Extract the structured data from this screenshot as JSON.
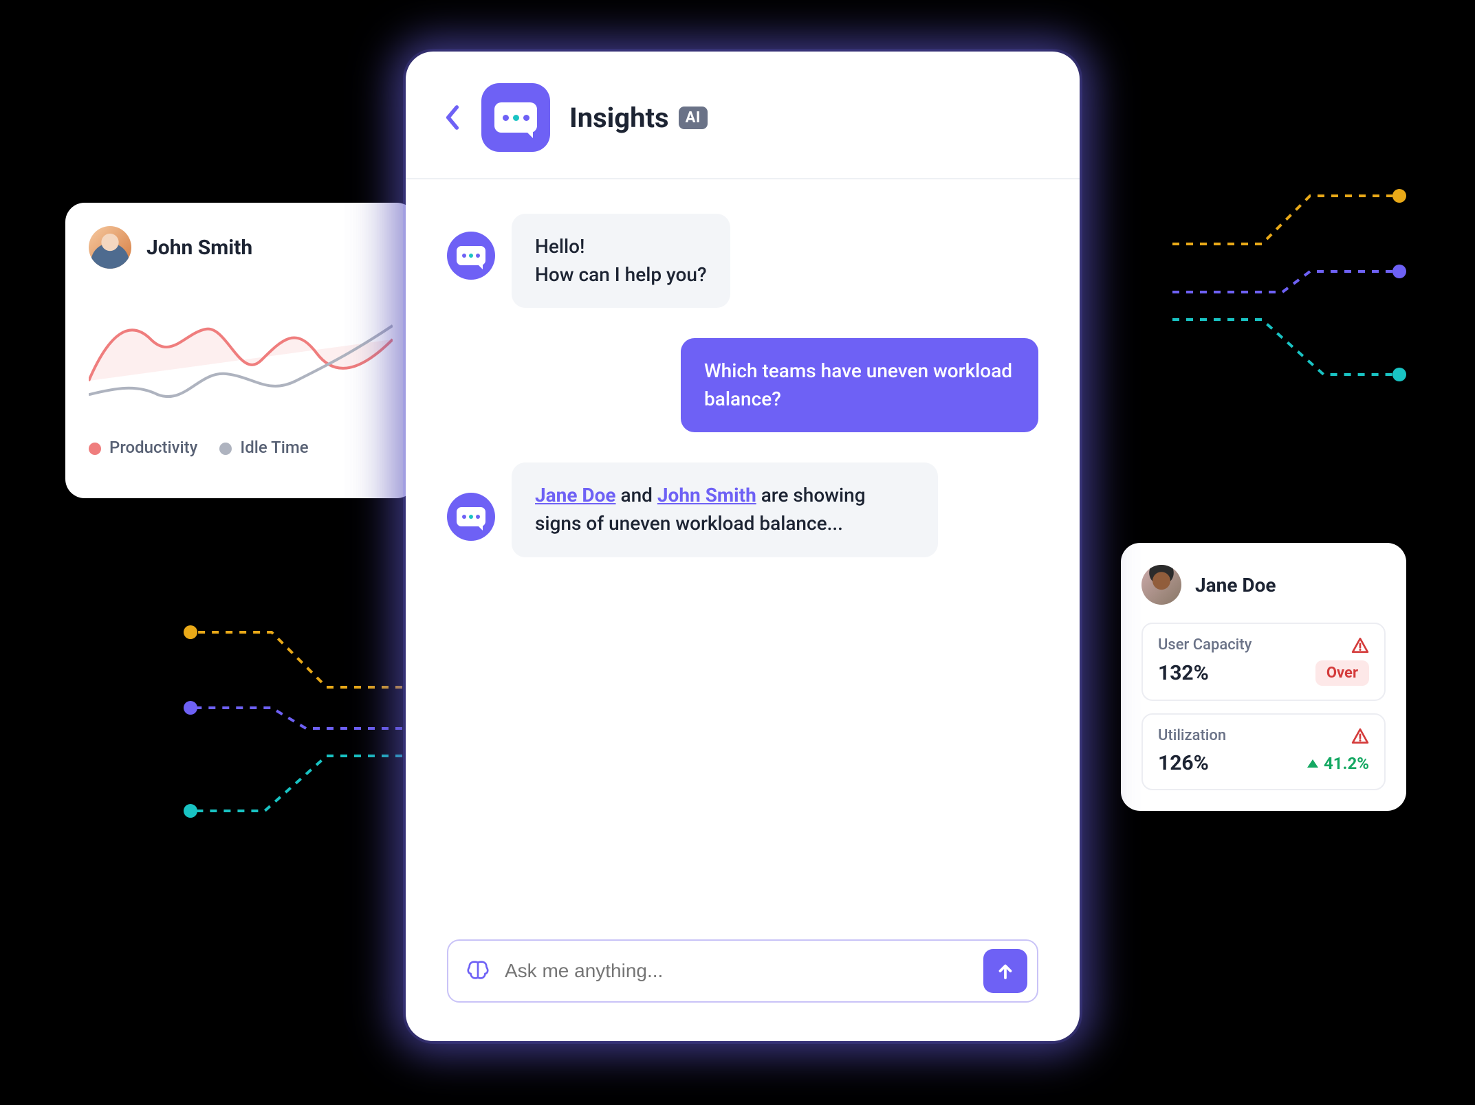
{
  "colors": {
    "accent": "#6e61f5",
    "productivity": "#ef7d7d",
    "idle": "#aeb3bf",
    "teal": "#19c3c3",
    "amber": "#e9a918",
    "green": "#14a862",
    "danger": "#d43b3b"
  },
  "left_card": {
    "name": "John Smith",
    "legend": {
      "productivity": "Productivity",
      "idle": "Idle Time"
    }
  },
  "right_card": {
    "name": "Jane Doe",
    "capacity": {
      "label": "User Capacity",
      "value": "132%",
      "status": "Over"
    },
    "utilization": {
      "label": "Utilization",
      "value": "126%",
      "delta": "41.2%"
    }
  },
  "panel": {
    "title": "Insights",
    "ai_tag": "AI",
    "messages": {
      "greeting_line1": "Hello!",
      "greeting_line2": "How can I help you?",
      "user_question": "Which teams have uneven workload balance?",
      "response_link1": "Jane Doe",
      "response_mid": " and ",
      "response_link2": "John Smith",
      "response_tail": " are showing signs of uneven workload balance..."
    },
    "input_placeholder": "Ask me anything..."
  }
}
